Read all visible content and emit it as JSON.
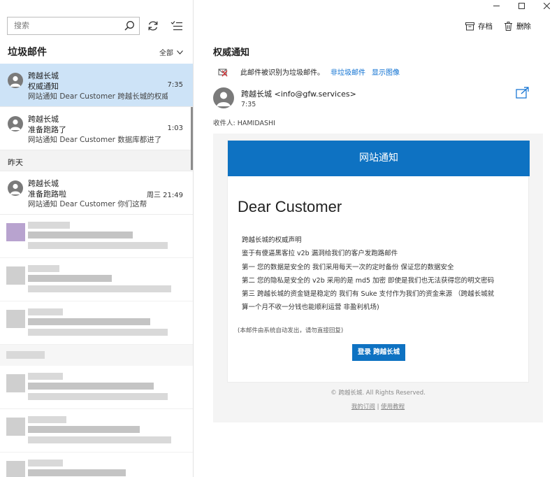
{
  "search": {
    "placeholder": "搜索"
  },
  "folder": {
    "title": "垃圾邮件",
    "filter_label": "全部"
  },
  "mail_list": {
    "items": [
      {
        "sender": "跨越长城",
        "subject": "权威通知",
        "time": "7:35",
        "preview": "网站通知 Dear Customer 跨越长城的权威"
      },
      {
        "sender": "跨越长城",
        "subject": "准备跑路了",
        "time": "1:03",
        "preview": "网站通知 Dear Customer 数据库都进了"
      }
    ],
    "date_separator": "昨天",
    "yesterday_items": [
      {
        "sender": "跨越长城",
        "subject": "准备跑路啦",
        "time": "周三 21:49",
        "preview": "网站通知 Dear Customer 你们这帮"
      }
    ]
  },
  "toolbar": {
    "archive_label": "存档",
    "delete_label": "删除",
    "more_label": "···"
  },
  "message": {
    "title": "权威通知",
    "junk_notice": "此邮件被识别为垃圾邮件。",
    "not_junk_link": "非垃圾邮件",
    "show_images_link": "显示图像",
    "sender": "跨越长城 <info@gfw.services>",
    "time": "7:35",
    "recipients": "收件人: HAMIDASHI"
  },
  "email": {
    "header_title": "网站通知",
    "heading": "Dear Customer",
    "lines": [
      "跨越长城的权威声明",
      "鉴于有傻逼黑客拉 v2b 漏洞给我们的客户发跑路邮件",
      "第一 您的数据是安全的 我们采用每天一次的定时备份 保证您的数据安全",
      "第二 您的隐私是安全的 v2b 采用的是 md5 加密 即使是我们也无法获得您的明文密码",
      "第三 跨越长城的资金链是稳定的 我们有 Suke 支付作为我们的资金来源 （跨越长城就",
      "算一个月不收一分钱也能顺利运营 非盈利机场)"
    ],
    "note": "(本邮件由系统自动发出，请勿直接回复)",
    "button_label": "登录 跨越长城",
    "footer_copyright": "© 跨越长城. All Rights Reserved.",
    "footer_link_1": "我的订阅",
    "footer_separator": "|",
    "footer_link_2": "使用教程"
  },
  "colors": {
    "accent": "#0e72c2",
    "selected_bg": "#cde3f7",
    "link": "#0a6ed1"
  }
}
